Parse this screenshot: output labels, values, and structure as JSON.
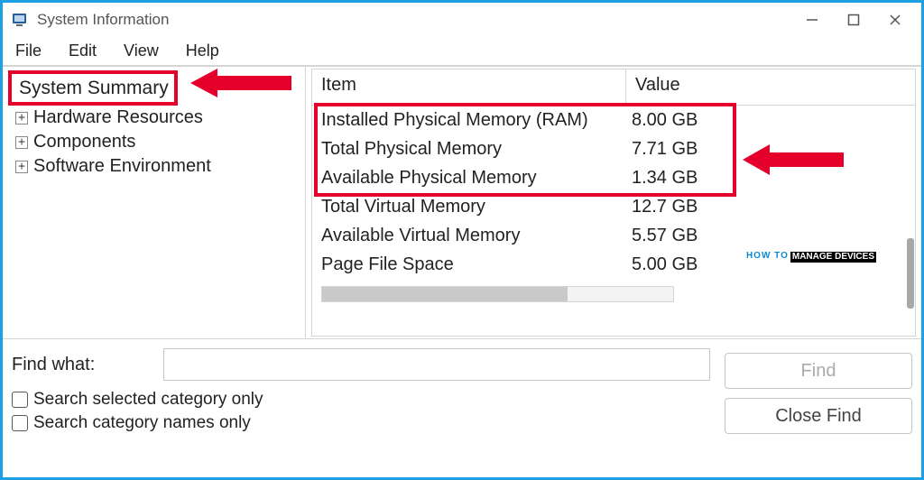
{
  "window": {
    "title": "System Information"
  },
  "menu": {
    "file": "File",
    "edit": "Edit",
    "view": "View",
    "help": "Help"
  },
  "tree": {
    "root": "System Summary",
    "children": [
      "Hardware Resources",
      "Components",
      "Software Environment"
    ]
  },
  "columns": {
    "item": "Item",
    "value": "Value"
  },
  "rows": [
    {
      "item": "Installed Physical Memory (RAM)",
      "value": "8.00 GB"
    },
    {
      "item": "Total Physical Memory",
      "value": "7.71 GB"
    },
    {
      "item": "Available Physical Memory",
      "value": "1.34 GB"
    },
    {
      "item": "Total Virtual Memory",
      "value": "12.7 GB"
    },
    {
      "item": "Available Virtual Memory",
      "value": "5.57 GB"
    },
    {
      "item": "Page File Space",
      "value": "5.00 GB"
    }
  ],
  "find": {
    "label": "Find what:",
    "placeholder": "",
    "find_btn": "Find",
    "close_btn": "Close Find",
    "opt_selected": "Search selected category only",
    "opt_names": "Search category names only"
  },
  "watermark": {
    "a": "HOW TO",
    "b": "MANAGE DEVICES"
  }
}
